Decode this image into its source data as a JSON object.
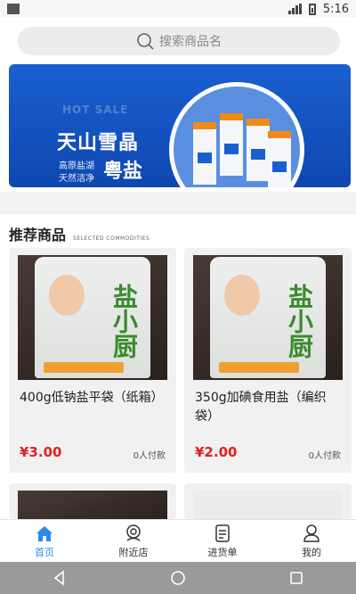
{
  "status_bar": {
    "time": "5:16"
  },
  "search": {
    "placeholder": "搜索商品名"
  },
  "banner": {
    "hot_label": "HOT SALE",
    "title": "天山雪晶",
    "line1": "高原盐湖",
    "line2": "天然洁净",
    "brand": "粤盐"
  },
  "recommended": {
    "title": "推荐商品",
    "subtitle": "SELECTED COMMODITIES",
    "products": [
      {
        "name": "400g低钠盐平袋（纸箱）",
        "price": "¥3.00",
        "sold": "0人付款"
      },
      {
        "name": "350g加碘食用盐（编织袋）",
        "price": "¥2.00",
        "sold": "0人付款"
      }
    ]
  },
  "tabbar": {
    "items": [
      {
        "label": "首页",
        "icon": "home-icon",
        "active": true
      },
      {
        "label": "附近店",
        "icon": "location-icon",
        "active": false
      },
      {
        "label": "进货单",
        "icon": "list-icon",
        "active": false
      },
      {
        "label": "我的",
        "icon": "user-icon",
        "active": false
      }
    ]
  },
  "colors": {
    "accent": "#2a8af0",
    "price": "#e02020",
    "banner": "#1a5fd0"
  }
}
